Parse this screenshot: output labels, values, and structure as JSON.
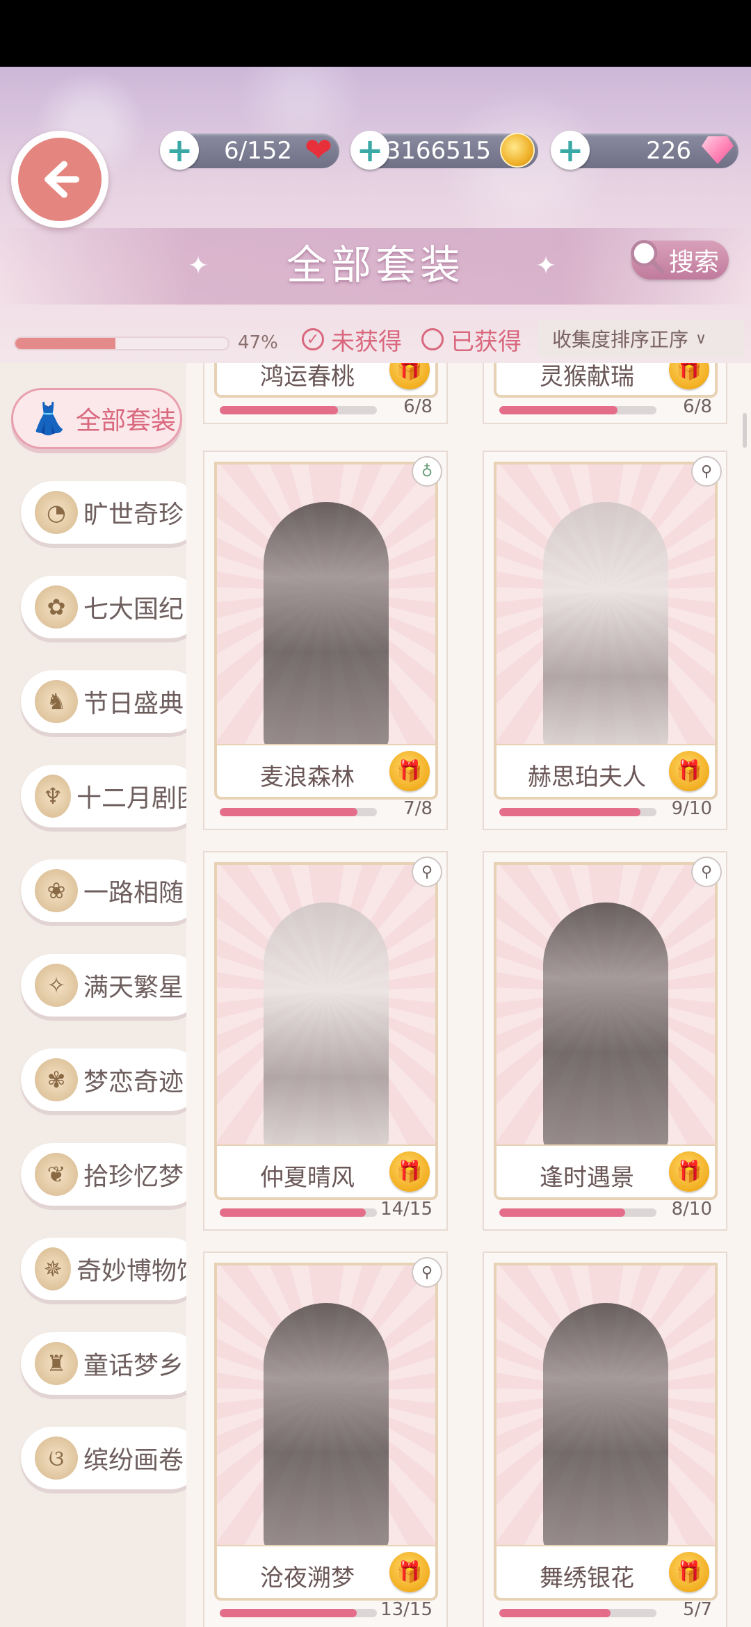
{
  "resources": {
    "hearts": "6/152",
    "gold": "3166515",
    "gems": "226"
  },
  "header": {
    "title": "全部套装",
    "search_label": "搜索",
    "progress_percent": 47,
    "progress_label": "47%",
    "filter_unowned": "未获得",
    "filter_owned": "已获得",
    "sort_label": "收集度排序正序"
  },
  "sidebar": {
    "items": [
      {
        "label": "全部套装",
        "icon": "dress-icon"
      },
      {
        "label": "旷世奇珍",
        "icon": "treasure-icon"
      },
      {
        "label": "七大国纪",
        "icon": "map-icon"
      },
      {
        "label": "节日盛典",
        "icon": "festival-icon"
      },
      {
        "label": "十二月剧团",
        "icon": "chandelier-icon"
      },
      {
        "label": "一路相随",
        "icon": "flower-icon"
      },
      {
        "label": "满天繁星",
        "icon": "constellation-icon"
      },
      {
        "label": "梦恋奇迹",
        "icon": "roses-icon"
      },
      {
        "label": "拾珍忆梦",
        "icon": "branch-icon"
      },
      {
        "label": "奇妙博物馆",
        "icon": "compass-icon"
      },
      {
        "label": "童话梦乡",
        "icon": "castle-icon"
      },
      {
        "label": "缤纷画卷",
        "icon": "butterfly-icon"
      }
    ]
  },
  "suits": [
    {
      "name": "鸿运春桃",
      "count": "6/8",
      "fraction": 0.75,
      "badge": ""
    },
    {
      "name": "灵猴献瑞",
      "count": "6/8",
      "fraction": 0.75,
      "badge": ""
    },
    {
      "name": "麦浪森林",
      "count": "7/8",
      "fraction": 0.875,
      "badge": "bottle-icon"
    },
    {
      "name": "赫思珀夫人",
      "count": "9/10",
      "fraction": 0.9,
      "badge": "pose-icon"
    },
    {
      "name": "仲夏晴风",
      "count": "14/15",
      "fraction": 0.93,
      "badge": "pose-icon"
    },
    {
      "name": "逢时遇景",
      "count": "8/10",
      "fraction": 0.8,
      "badge": "pose-icon"
    },
    {
      "name": "沧夜溯梦",
      "count": "13/15",
      "fraction": 0.87,
      "badge": "pose-icon"
    },
    {
      "name": "舞绣银花",
      "count": "5/7",
      "fraction": 0.71,
      "badge": ""
    }
  ]
}
